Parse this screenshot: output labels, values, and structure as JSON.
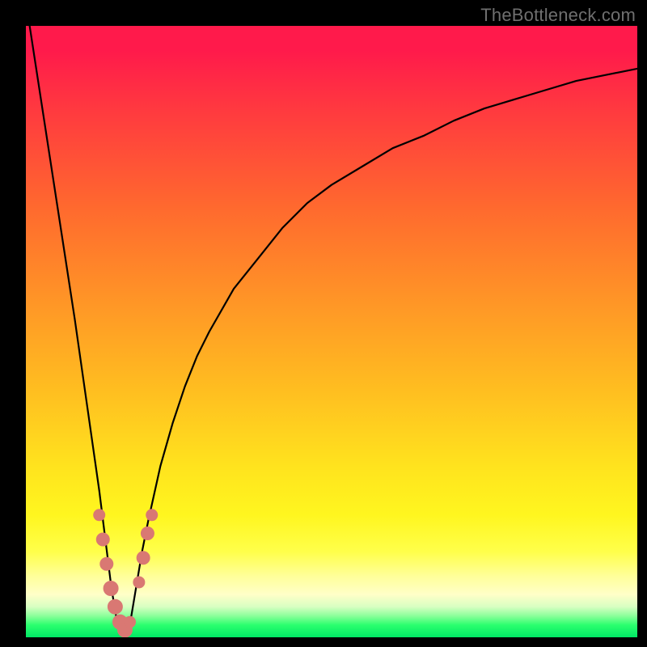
{
  "watermark": {
    "text": "TheBottleneck.com"
  },
  "colors": {
    "marker": "#d97873",
    "curve": "#000000",
    "frame": "#000000"
  },
  "chart_data": {
    "type": "line",
    "title": "",
    "xlabel": "",
    "ylabel": "",
    "xlim": [
      0,
      100
    ],
    "ylim": [
      0,
      100
    ],
    "grid": false,
    "legend": false,
    "annotations": [],
    "series": [
      {
        "name": "bottleneck_curve",
        "x": [
          0,
          2,
          4,
          6,
          8,
          10,
          11,
          12,
          13,
          14,
          15,
          16,
          17,
          18,
          19,
          20,
          22,
          24,
          26,
          28,
          30,
          34,
          38,
          42,
          46,
          50,
          55,
          60,
          65,
          70,
          75,
          80,
          85,
          90,
          95,
          100
        ],
        "y": [
          104,
          91,
          78,
          65,
          52,
          38,
          31,
          24,
          16,
          8,
          2,
          0,
          2,
          8,
          14,
          19,
          28,
          35,
          41,
          46,
          50,
          57,
          62,
          67,
          71,
          74,
          77,
          80,
          82,
          84.5,
          86.5,
          88,
          89.5,
          91,
          92,
          93
        ]
      }
    ],
    "markers": {
      "name": "highlighted_points",
      "color": "#d97873",
      "points": [
        {
          "x": 12.0,
          "y": 20,
          "r": 7
        },
        {
          "x": 12.6,
          "y": 16,
          "r": 8
        },
        {
          "x": 13.2,
          "y": 12,
          "r": 8
        },
        {
          "x": 13.9,
          "y": 8,
          "r": 9
        },
        {
          "x": 14.6,
          "y": 5,
          "r": 9
        },
        {
          "x": 15.4,
          "y": 2.5,
          "r": 9
        },
        {
          "x": 16.2,
          "y": 1.2,
          "r": 9
        },
        {
          "x": 17.0,
          "y": 2.5,
          "r": 7
        },
        {
          "x": 18.5,
          "y": 9,
          "r": 7
        },
        {
          "x": 19.2,
          "y": 13,
          "r": 8
        },
        {
          "x": 19.9,
          "y": 17,
          "r": 8
        },
        {
          "x": 20.6,
          "y": 20,
          "r": 7
        }
      ]
    }
  }
}
